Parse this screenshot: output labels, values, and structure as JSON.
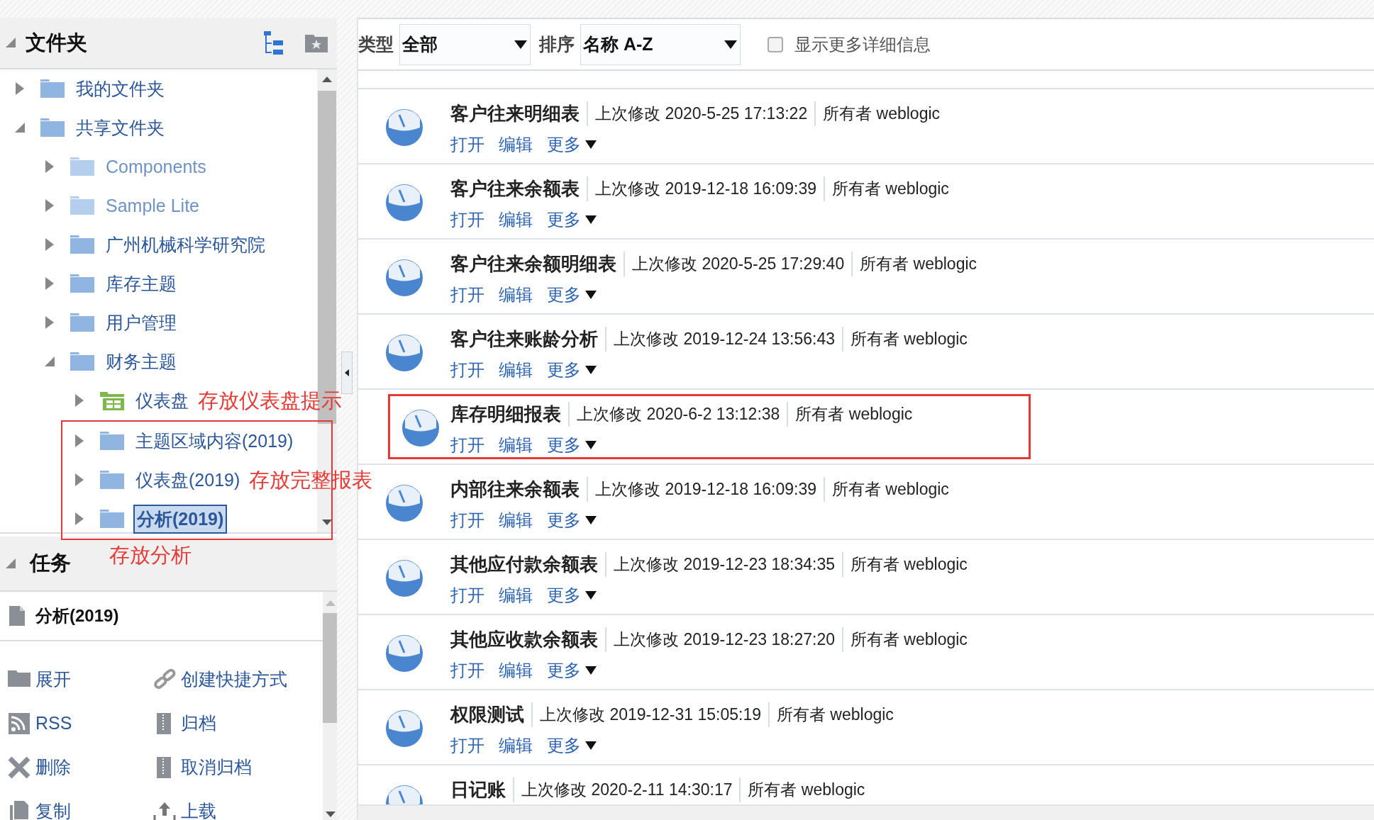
{
  "folders": {
    "title": "文件夹",
    "expanded": true,
    "tree": [
      {
        "label": "我的文件夹",
        "kind": "folder",
        "expanded": false,
        "dimmed": false,
        "selected": false,
        "highlighted": false
      },
      {
        "label": "共享文件夹",
        "kind": "folder",
        "expanded": true,
        "dimmed": false,
        "selected": false,
        "highlighted": false,
        "children": [
          {
            "label": "Components",
            "kind": "folder",
            "expanded": false,
            "dimmed": true,
            "selected": false,
            "highlighted": false
          },
          {
            "label": "Sample Lite",
            "kind": "folder",
            "expanded": false,
            "dimmed": true,
            "selected": false,
            "highlighted": false
          },
          {
            "label": "广州机械科学研究院",
            "kind": "folder",
            "expanded": false,
            "dimmed": false,
            "selected": false,
            "highlighted": false
          },
          {
            "label": "库存主题",
            "kind": "folder",
            "expanded": false,
            "dimmed": false,
            "selected": false,
            "highlighted": false
          },
          {
            "label": "用户管理",
            "kind": "folder",
            "expanded": false,
            "dimmed": false,
            "selected": false,
            "highlighted": false
          },
          {
            "label": "财务主题",
            "kind": "folder",
            "expanded": true,
            "dimmed": false,
            "selected": false,
            "highlighted": false,
            "children": [
              {
                "label": "仪表盘",
                "kind": "dashboard",
                "expanded": false,
                "dimmed": false,
                "selected": false,
                "highlighted": false,
                "note": "存放仪表盘提示"
              },
              {
                "label": "主题区域内容(2019)",
                "kind": "folder",
                "expanded": false,
                "dimmed": false,
                "selected": false,
                "highlighted": true
              },
              {
                "label": "仪表盘(2019)",
                "kind": "folder",
                "expanded": false,
                "dimmed": false,
                "selected": false,
                "highlighted": true,
                "note": "存放完整报表"
              },
              {
                "label": "分析(2019)",
                "kind": "folder",
                "expanded": false,
                "dimmed": false,
                "selected": true,
                "highlighted": true
              }
            ]
          }
        ]
      }
    ]
  },
  "tasks": {
    "title": "任务",
    "expanded": true,
    "note": "存放分析",
    "item": "分析(2019)",
    "actions": [
      {
        "label": "展开"
      },
      {
        "label": "创建快捷方式"
      },
      {
        "label": "RSS"
      },
      {
        "label": "归档"
      },
      {
        "label": "删除"
      },
      {
        "label": "取消归档"
      },
      {
        "label": "复制"
      },
      {
        "label": "上载"
      }
    ]
  },
  "toolbar": {
    "type_label": "类型",
    "type_value": "全部",
    "sort_label": "排序",
    "sort_value": "名称 A-Z",
    "details": {
      "label": "显示更多详细信息",
      "checked": false
    }
  },
  "items": [
    {
      "title": "客户往来明细表",
      "modified": "上次修改 2020-5-25 17:13:22",
      "owner": "所有者 weblogic",
      "links": [
        "打开",
        "编辑",
        "更多"
      ],
      "highlighted": false
    },
    {
      "title": "客户往来余额表",
      "modified": "上次修改 2019-12-18 16:09:39",
      "owner": "所有者 weblogic",
      "links": [
        "打开",
        "编辑",
        "更多"
      ],
      "highlighted": false
    },
    {
      "title": "客户往来余额明细表",
      "modified": "上次修改 2020-5-25 17:29:40",
      "owner": "所有者 weblogic",
      "links": [
        "打开",
        "编辑",
        "更多"
      ],
      "highlighted": false
    },
    {
      "title": "客户往来账龄分析",
      "modified": "上次修改 2019-12-24 13:56:43",
      "owner": "所有者 weblogic",
      "links": [
        "打开",
        "编辑",
        "更多"
      ],
      "highlighted": false
    },
    {
      "title": "库存明细报表",
      "modified": "上次修改 2020-6-2 13:12:38",
      "owner": "所有者 weblogic",
      "links": [
        "打开",
        "编辑",
        "更多"
      ],
      "highlighted": true
    },
    {
      "title": "内部往来余额表",
      "modified": "上次修改 2019-12-18 16:09:39",
      "owner": "所有者 weblogic",
      "links": [
        "打开",
        "编辑",
        "更多"
      ],
      "highlighted": false
    },
    {
      "title": "其他应付款余额表",
      "modified": "上次修改 2019-12-23 18:34:35",
      "owner": "所有者 weblogic",
      "links": [
        "打开",
        "编辑",
        "更多"
      ],
      "highlighted": false
    },
    {
      "title": "其他应收款余额表",
      "modified": "上次修改 2019-12-23 18:27:20",
      "owner": "所有者 weblogic",
      "links": [
        "打开",
        "编辑",
        "更多"
      ],
      "highlighted": false
    },
    {
      "title": "权限测试",
      "modified": "上次修改 2019-12-31 15:05:19",
      "owner": "所有者 weblogic",
      "links": [
        "打开",
        "编辑",
        "更多"
      ],
      "highlighted": false
    },
    {
      "title": "日记账",
      "modified": "上次修改 2020-2-11 14:30:17",
      "owner": "所有者 weblogic",
      "highlighted": false
    }
  ]
}
